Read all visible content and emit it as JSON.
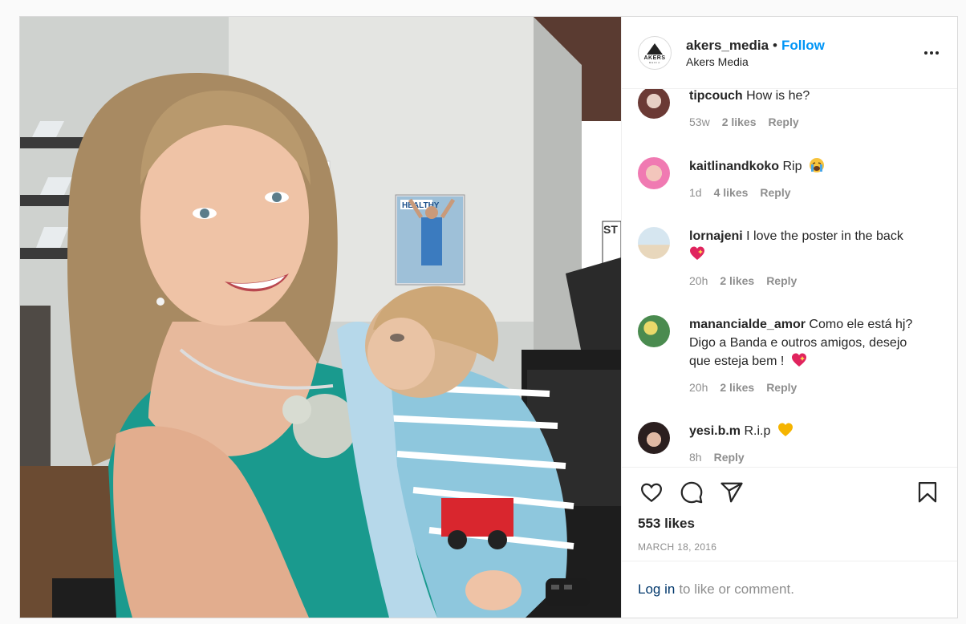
{
  "post": {
    "account": {
      "username": "akers_media",
      "separator": "•",
      "follow_label": "Follow",
      "display_name": "Akers Media",
      "logo_text": "AKERS",
      "logo_subtext": "MEDIA"
    },
    "photo": {
      "poster_headline": "HEALTHY",
      "sign_text": "ST"
    },
    "comments": [
      {
        "username": "tipcouch",
        "text": "How is he?",
        "age": "53w",
        "likes": "2 likes",
        "reply": "Reply"
      },
      {
        "username": "kaitlinandkoko",
        "text": "Rip",
        "emoji": "loudly-crying-face",
        "age": "1d",
        "likes": "4 likes",
        "reply": "Reply"
      },
      {
        "username": "lornajeni",
        "text": "I love the poster in the back",
        "emoji": "sparkling-heart",
        "age": "20h",
        "likes": "2 likes",
        "reply": "Reply"
      },
      {
        "username": "manancialde_amor",
        "text": "Como ele está hj? Digo a Banda e outros amigos, desejo que esteja bem !",
        "emoji": "sparkling-heart",
        "age": "20h",
        "likes": "2 likes",
        "reply": "Reply"
      },
      {
        "username": "yesi.b.m",
        "text": "R.i.p",
        "emoji": "yellow-heart",
        "age": "8h",
        "reply": "Reply"
      }
    ],
    "likes_count": "553 likes",
    "date": "MARCH 18, 2016",
    "login_prompt": {
      "link": "Log in",
      "rest": "to like or comment."
    },
    "colors": {
      "accent": "#0095f6",
      "link_dark": "#00376b",
      "muted": "#8e8e8e",
      "text": "#262626",
      "border": "#dbdbdb"
    }
  }
}
